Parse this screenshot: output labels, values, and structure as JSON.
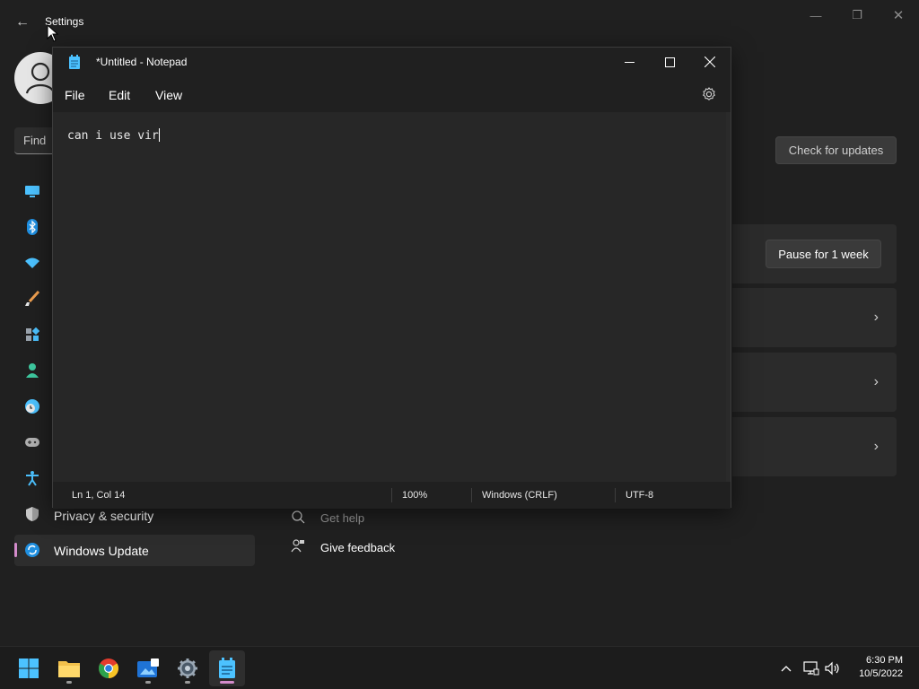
{
  "settings": {
    "title": "Settings",
    "search_placeholder": "Find",
    "nav_items": [
      {
        "label": "Privacy & security",
        "icon": "shield-icon"
      },
      {
        "label": "Windows Update",
        "icon": "windows-update-icon",
        "selected": true
      }
    ],
    "check_updates_label": "Check for updates",
    "pause_label": "Pause for 1 week",
    "links": [
      {
        "label": "Get help",
        "icon": "help-icon"
      },
      {
        "label": "Give feedback",
        "icon": "feedback-icon"
      }
    ]
  },
  "notepad": {
    "title": "*Untitled - Notepad",
    "menu": [
      "File",
      "Edit",
      "View"
    ],
    "content": "can i use vir",
    "status": {
      "position": "Ln 1, Col 14",
      "zoom": "100%",
      "line_ending": "Windows (CRLF)",
      "encoding": "UTF-8"
    }
  },
  "taskbar": {
    "apps": [
      "start",
      "file-explorer",
      "chrome",
      "photos",
      "settings",
      "notepad"
    ],
    "active_app": "notepad",
    "time": "6:30 PM",
    "date": "10/5/2022"
  },
  "colors": {
    "accent": "#d38bcb",
    "window_bg": "#202020",
    "editor_bg": "#272727"
  }
}
